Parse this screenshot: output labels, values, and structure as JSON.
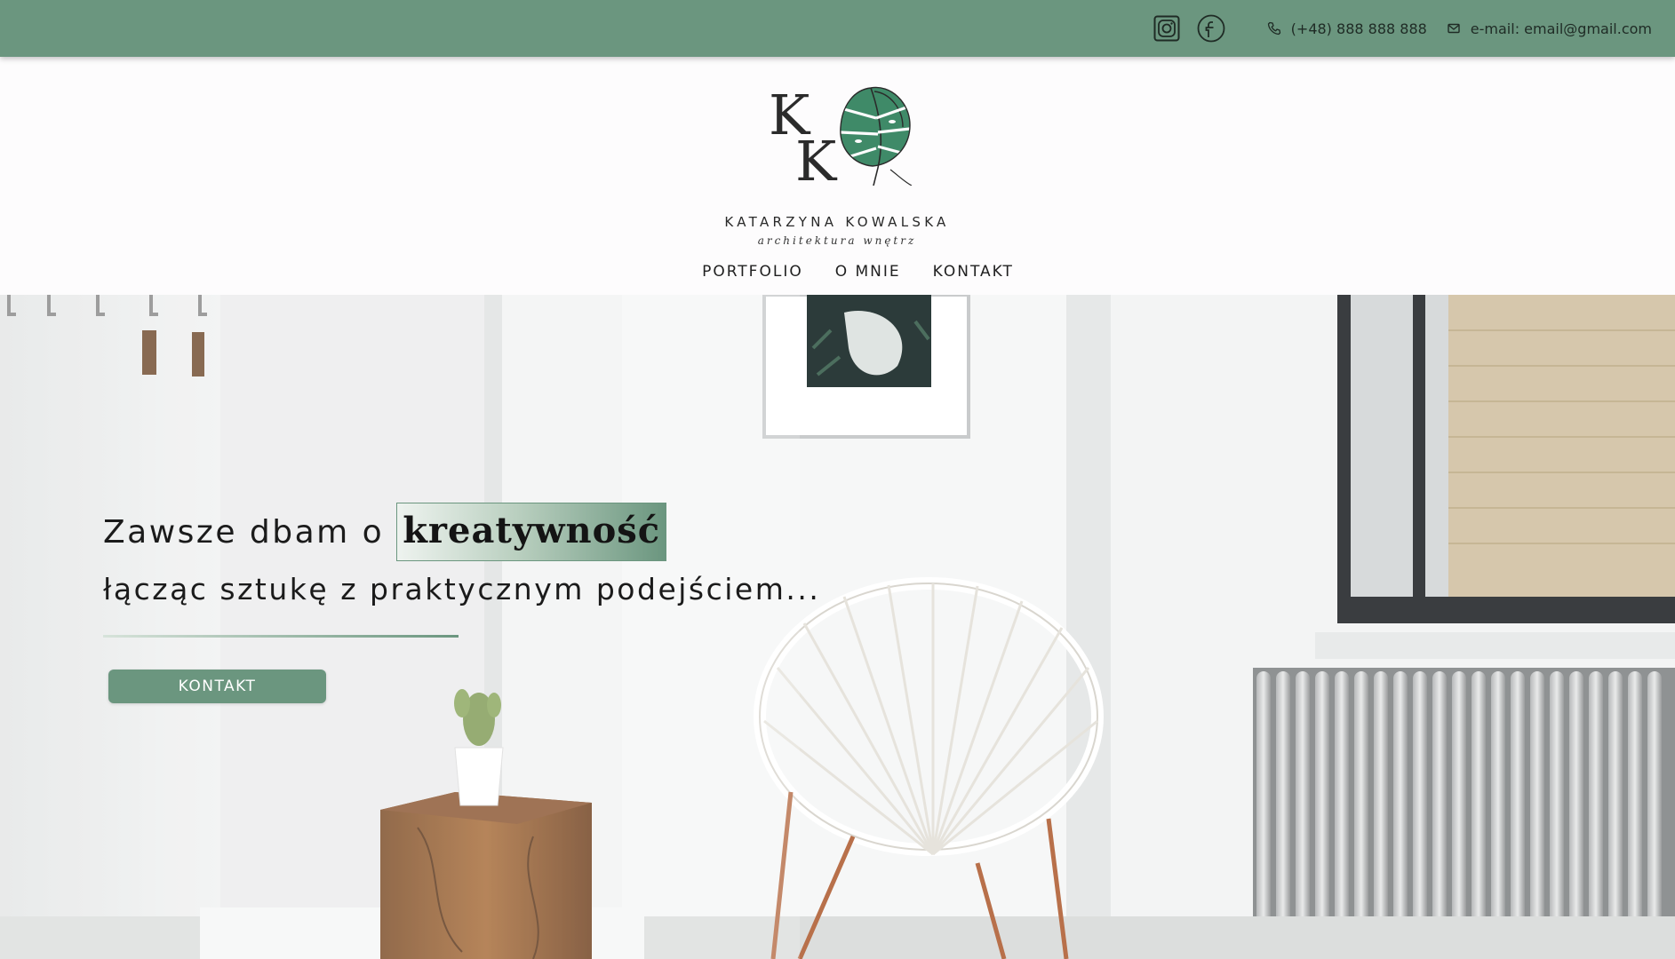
{
  "topbar": {
    "social": [
      {
        "icon": "instagram-icon"
      },
      {
        "icon": "facebook-icon"
      }
    ],
    "phone": {
      "icon": "phone-icon",
      "text": "(+48) 888 888 888"
    },
    "email": {
      "icon": "mail-icon",
      "text": "e-mail: email@gmail.com"
    },
    "background": "#6b967f"
  },
  "logo": {
    "monogram_letters": "KK",
    "brand": "KATARZYNA KOWALSKA",
    "tagline": "architektura wnętrz"
  },
  "nav": {
    "items": [
      "PORTFOLIO",
      "O MNIE",
      "KONTAKT"
    ]
  },
  "hero": {
    "line1": "Zawsze dbam o",
    "highlight": "kreatywność",
    "line2": "łącząc sztukę z praktycznym podejściem...",
    "cta_label": "KONTAKT",
    "accent": "#6b967f"
  }
}
